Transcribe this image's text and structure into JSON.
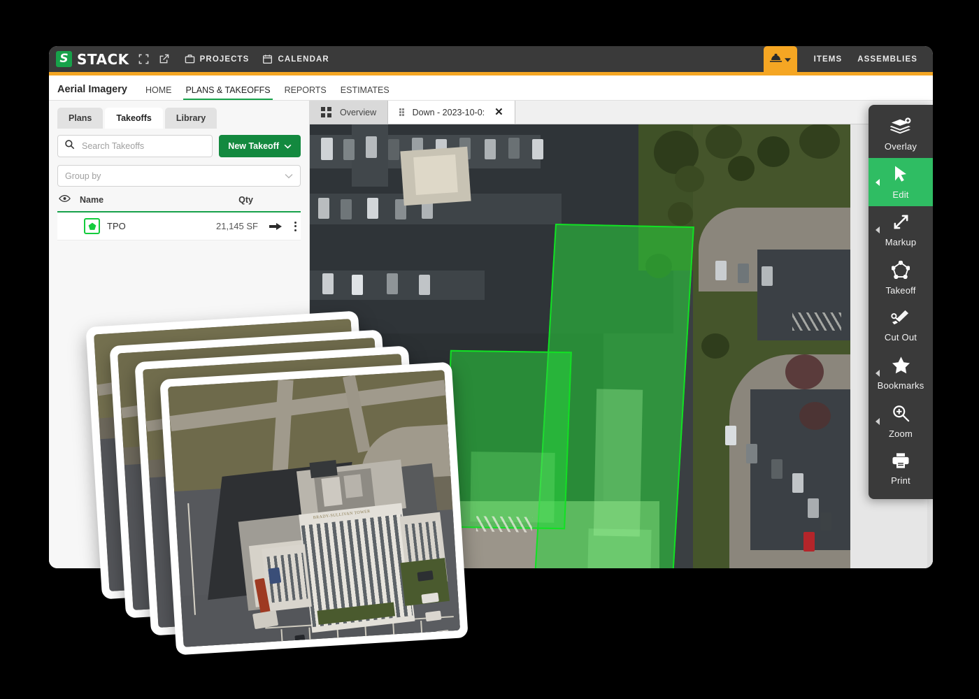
{
  "topbar": {
    "logo_letter": "S",
    "brand": "STACK",
    "icons": [
      "expand-icon",
      "external-link-icon"
    ],
    "links": [
      {
        "label": "PROJECTS",
        "icon": "briefcase-icon"
      },
      {
        "label": "CALENDAR",
        "icon": "calendar-icon"
      }
    ],
    "hat_button": {
      "icon": "hard-hat-icon",
      "caret": "chevron-down-icon"
    },
    "right_links": [
      "ITEMS",
      "ASSEMBLIES"
    ],
    "accent_color": "#f5a623",
    "bg_color": "#3a3a3a"
  },
  "subnav": {
    "title": "Aerial Imagery",
    "items": [
      {
        "label": "HOME",
        "active": false
      },
      {
        "label": "PLANS & TAKEOFFS",
        "active": true
      },
      {
        "label": "REPORTS",
        "active": false
      },
      {
        "label": "ESTIMATES",
        "active": false
      }
    ],
    "active_color": "#17a24a"
  },
  "left_panel": {
    "tabs": [
      {
        "label": "Plans",
        "active": false
      },
      {
        "label": "Takeoffs",
        "active": true
      },
      {
        "label": "Library",
        "active": false
      }
    ],
    "search": {
      "placeholder": "Search Takeoffs",
      "value": ""
    },
    "new_takeoff_button": {
      "label": "New Takeoff",
      "caret": "chevron-down-icon",
      "color": "#13893f"
    },
    "group_by": {
      "placeholder": "Group by",
      "value": ""
    },
    "table": {
      "columns": [
        "Name",
        "Qty"
      ],
      "visibility_icon": "eye-icon",
      "rows": [
        {
          "swatch_color": "#14cc3d",
          "name": "TPO",
          "qty": "21,145 SF",
          "goto_icon": "arrow-right-icon",
          "menu_icon": "kebab-menu-icon"
        }
      ]
    }
  },
  "map": {
    "tabs": [
      {
        "label": "Overview",
        "icon": "grid-icon",
        "active": false,
        "closable": false
      },
      {
        "label": "Down - 2023-10-0:",
        "icon": "drag-handle-icon",
        "active": true,
        "closable": true,
        "close_icon": "close-icon"
      }
    ],
    "takeoff_fill": "#28d73c",
    "takeoff_stroke": "#12e024"
  },
  "toolbar": {
    "items": [
      {
        "label": "Overlay",
        "icon": "layers-add-icon",
        "active": false,
        "has_caret": false
      },
      {
        "label": "Edit",
        "icon": "cursor-icon",
        "active": true,
        "has_caret": true
      },
      {
        "label": "Markup",
        "icon": "resize-arrows-icon",
        "active": false,
        "has_caret": true
      },
      {
        "label": "Takeoff",
        "icon": "pentagon-icon",
        "active": false,
        "has_caret": false
      },
      {
        "label": "Cut Out",
        "icon": "scissors-cut-icon",
        "active": false,
        "has_caret": false
      },
      {
        "label": "Bookmarks",
        "icon": "star-icon",
        "active": false,
        "has_caret": true
      },
      {
        "label": "Zoom",
        "icon": "magnifier-plus-icon",
        "active": false,
        "has_caret": true
      },
      {
        "label": "Print",
        "icon": "printer-icon",
        "active": false,
        "has_caret": false
      }
    ],
    "active_color": "#2fbd63",
    "bg_color": "#3a3a3a"
  },
  "photo_stack": {
    "count": 4,
    "building_label": "BRADY-SULLIVAN TOWER"
  }
}
